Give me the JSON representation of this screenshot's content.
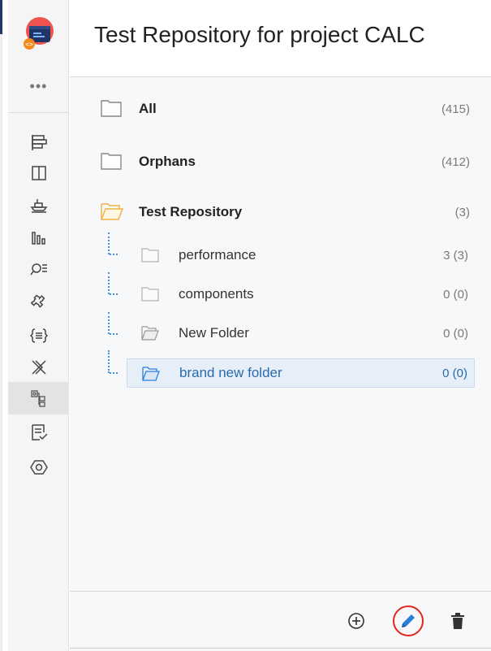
{
  "page": {
    "title": "Test Repository for project CALC"
  },
  "sidebar": {
    "more_label": "•••",
    "items": [
      {
        "name": "sidebar-item-plan",
        "icon": "plan-layout-icon"
      },
      {
        "name": "sidebar-item-board",
        "icon": "columns-icon"
      },
      {
        "name": "sidebar-item-release",
        "icon": "ship-icon"
      },
      {
        "name": "sidebar-item-reports",
        "icon": "bar-chart-icon"
      },
      {
        "name": "sidebar-item-search",
        "icon": "search-filter-icon"
      },
      {
        "name": "sidebar-item-addons",
        "icon": "puzzle-icon"
      },
      {
        "name": "sidebar-item-code",
        "icon": "code-list-icon"
      },
      {
        "name": "sidebar-item-xray",
        "icon": "xray-icon"
      },
      {
        "name": "sidebar-item-test-repository",
        "icon": "tree-hierarchy-icon",
        "active": true
      },
      {
        "name": "sidebar-item-test-plans",
        "icon": "checklist-icon"
      },
      {
        "name": "sidebar-item-settings",
        "icon": "hexagon-settings-icon"
      }
    ]
  },
  "tree": {
    "all": {
      "label": "All",
      "count": "(415)"
    },
    "orphans": {
      "label": "Orphans",
      "count": "(412)"
    },
    "test_repository": {
      "label": "Test Repository",
      "count": "(3)"
    },
    "children": [
      {
        "label": "performance",
        "count": "3 (3)"
      },
      {
        "label": "components",
        "count": "0 (0)"
      },
      {
        "label": "New Folder",
        "count": "0 (0)"
      },
      {
        "label": "brand new folder",
        "count": "0 (0)",
        "selected": true
      }
    ]
  },
  "footer": {
    "buttons": [
      "add-circle-icon",
      "pencil-edit-icon",
      "trash-icon"
    ],
    "colors": {
      "edit_highlight": "#e5231f",
      "edit_icon": "#2b7fd6",
      "selected_text": "#2b6aad",
      "folder_open": "#f0b040"
    }
  }
}
